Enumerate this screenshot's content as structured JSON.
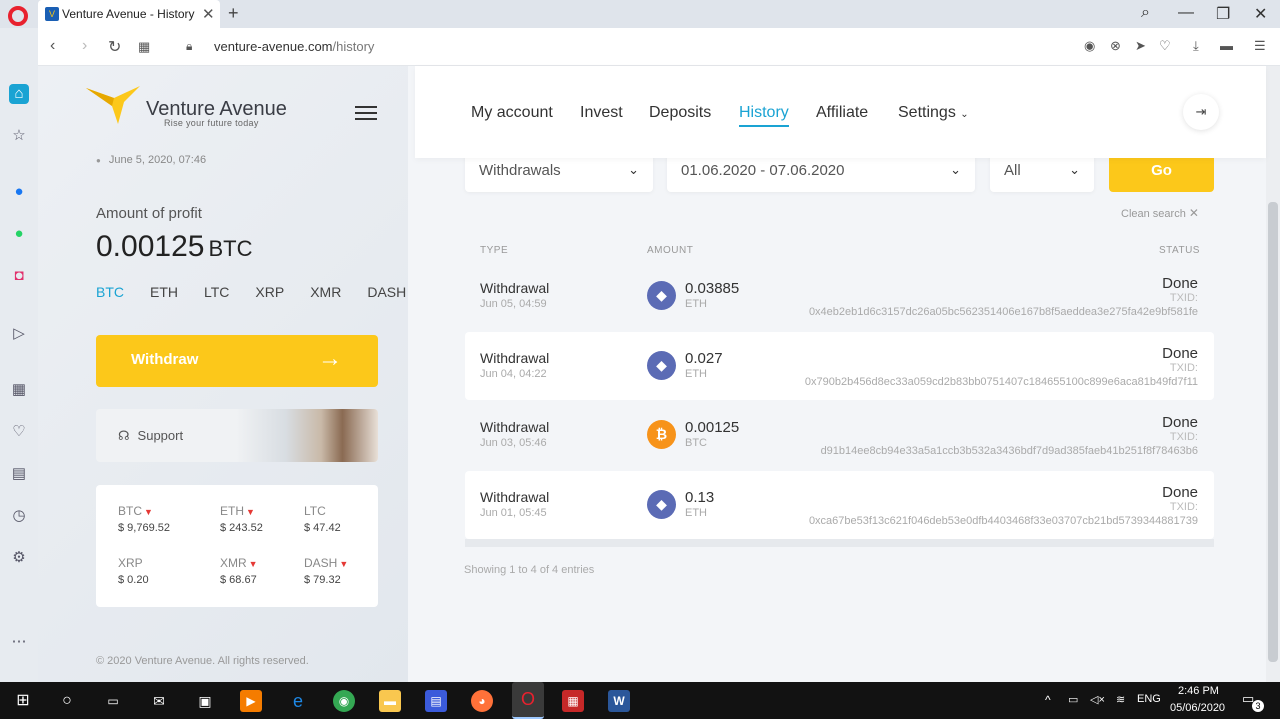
{
  "browser": {
    "tab_title": "Venture Avenue - History",
    "url_domain": "venture-avenue.com",
    "url_path": "/history"
  },
  "brand": {
    "name": "Venture Avenue",
    "tagline": "Rise your future today",
    "accent": "#fcc81a",
    "link_color": "#1aa3d3"
  },
  "sidebar": {
    "datetime": "June 5, 2020, 07:46",
    "profit_label": "Amount of profit",
    "profit_value": "0.00125",
    "profit_unit": "BTC",
    "coins": [
      "BTC",
      "ETH",
      "LTC",
      "XRP",
      "XMR",
      "DASH"
    ],
    "active_coin": "BTC",
    "withdraw_label": "Withdraw",
    "support_label": "Support",
    "prices": [
      {
        "name": "BTC",
        "value": "$ 9,769.52",
        "down": true
      },
      {
        "name": "ETH",
        "value": "$ 243.52",
        "down": true
      },
      {
        "name": "LTC",
        "value": "$ 47.42",
        "down": false
      },
      {
        "name": "XRP",
        "value": "$ 0.20",
        "down": false
      },
      {
        "name": "XMR",
        "value": "$ 68.67",
        "down": true
      },
      {
        "name": "DASH",
        "value": "$ 79.32",
        "down": true
      }
    ],
    "copyright": "© 2020 Venture Avenue. All rights reserved."
  },
  "nav": {
    "items": [
      "My account",
      "Invest",
      "Deposits",
      "History",
      "Affiliate",
      "Settings"
    ],
    "active": "History"
  },
  "filters": {
    "type": "Withdrawals",
    "date_range": "01.06.2020 - 07.06.2020",
    "status": "All",
    "go_label": "Go",
    "clean_search": "Clean search"
  },
  "table": {
    "headers": {
      "type": "TYPE",
      "amount": "AMOUNT",
      "status": "STATUS"
    },
    "txid_label": "TXID:",
    "rows": [
      {
        "type": "Withdrawal",
        "date": "Jun 05, 04:59",
        "amount": "0.03885",
        "currency": "ETH",
        "status": "Done",
        "txid": "0x4eb2eb1d6c3157dc26a05bc562351406e167b8f5aeddea3e275fa42e9bf581fe"
      },
      {
        "type": "Withdrawal",
        "date": "Jun 04, 04:22",
        "amount": "0.027",
        "currency": "ETH",
        "status": "Done",
        "txid": "0x790b2b456d8ec33a059cd2b83bb0751407c184655100c899e6aca81b49fd7f11"
      },
      {
        "type": "Withdrawal",
        "date": "Jun 03, 05:46",
        "amount": "0.00125",
        "currency": "BTC",
        "status": "Done",
        "txid": "d91b14ee8cb94e33a5a1ccb3b532a3436bdf7d9ad385faeb41b251f8f78463b6"
      },
      {
        "type": "Withdrawal",
        "date": "Jun 01, 05:45",
        "amount": "0.13",
        "currency": "ETH",
        "status": "Done",
        "txid": "0xca67be53f13c621f046deb53e0dfb4403468f33e03707cb21bd5739344881739"
      }
    ],
    "showing": "Showing 1 to 4 of 4 entries"
  },
  "taskbar": {
    "lang": "ENG",
    "time": "2:46 PM",
    "date": "05/06/2020",
    "notifications": "3"
  }
}
